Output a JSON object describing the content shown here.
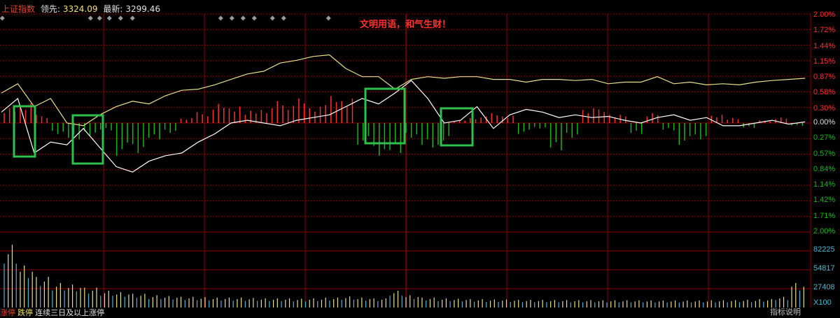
{
  "header": {
    "index_name": "上证指数",
    "lead_label": "领先:",
    "lead_value": "3324.09",
    "last_label": "最新:",
    "last_value": "3299.46"
  },
  "banner": "文明用语，和气生财！",
  "footer": {
    "seg1": "涨停",
    "seg2": "跌停",
    "seg3": "连续三日及以上涨停"
  },
  "indicator_button": "指标说明",
  "colors": {
    "background": "#000000",
    "grid": "#8b0000",
    "up": "#ff2f2f",
    "down": "#17b517",
    "white_line": "#ffffff",
    "yellow_line": "#e8df8e",
    "volume": "#e8df8e",
    "volume_alt": "#4fb4d4",
    "highlight_box": "#2fbf4f"
  },
  "chart_data": {
    "type": "line",
    "price_ticks_upper": [
      "2.00%",
      "1.72%",
      "1.44%",
      "1.15%",
      "0.87%",
      "0.58%",
      "0.30%"
    ],
    "price_tick_zero": "0.00%",
    "price_ticks_lower": [
      "0.27%",
      "0.57%",
      "0.84%",
      "1.14%",
      "1.42%",
      "1.71%",
      "2.00%"
    ],
    "volume_ticks": [
      "82225",
      "54817",
      "27408"
    ],
    "volume_unit": "X100",
    "ylim_percent": [
      -2.0,
      2.0
    ],
    "series": [
      {
        "name": "",
        "color": "white",
        "values": [
          0.2,
          0.45,
          -0.55,
          -0.35,
          -0.4,
          -0.1,
          -0.45,
          -0.8,
          -0.9,
          -0.7,
          -0.6,
          -0.55,
          -0.35,
          -0.2,
          0.0,
          0.05,
          0.0,
          -0.05,
          0.05,
          0.1,
          0.15,
          0.3,
          0.45,
          0.35,
          0.55,
          0.78,
          0.45,
          0.0,
          0.05,
          0.3,
          -0.1,
          0.15,
          0.25,
          0.2,
          0.1,
          0.15,
          0.1,
          0.12,
          0.05,
          0.0,
          0.1,
          0.15,
          0.05,
          0.1,
          -0.05,
          -0.05,
          0.0,
          0.05,
          -0.02,
          0.02
        ]
      },
      {
        "name": "",
        "color": "yellow",
        "values": [
          0.55,
          0.72,
          0.3,
          0.45,
          0.0,
          -0.05,
          0.15,
          0.3,
          0.4,
          0.35,
          0.5,
          0.6,
          0.62,
          0.7,
          0.8,
          0.9,
          0.95,
          1.1,
          1.15,
          1.22,
          1.25,
          1.0,
          0.85,
          0.85,
          0.62,
          0.8,
          0.85,
          0.82,
          0.85,
          0.85,
          0.8,
          0.8,
          0.75,
          0.8,
          0.8,
          0.78,
          0.8,
          0.72,
          0.75,
          0.75,
          0.85,
          0.72,
          0.75,
          0.7,
          0.72,
          0.7,
          0.75,
          0.78,
          0.8,
          0.82
        ]
      }
    ],
    "bars": [
      0.3,
      0.4,
      0.15,
      -0.2,
      -0.3,
      -0.25,
      -0.15,
      -0.6,
      -0.55,
      -0.3,
      -0.2,
      0.1,
      0.2,
      0.35,
      0.3,
      0.25,
      0.3,
      0.4,
      0.45,
      0.3,
      0.55,
      0.5,
      -0.4,
      -0.6,
      -0.55,
      -0.3,
      -0.5,
      -0.4,
      0.05,
      0.1,
      0.2,
      0.15,
      -0.2,
      -0.1,
      -0.5,
      -0.3,
      0.3,
      0.25,
      0.15,
      -0.2,
      0.2,
      -0.15,
      -0.4,
      -0.3,
      0.15,
      0.1,
      -0.1,
      0.05,
      0.1,
      -0.05
    ],
    "volumes": [
      82000,
      55000,
      40000,
      32000,
      30000,
      26000,
      22000,
      20000,
      18000,
      16000,
      15000,
      14000,
      13500,
      13000,
      13000,
      12500,
      12000,
      12000,
      11500,
      12000,
      13000,
      14500,
      13000,
      12000,
      22000,
      16000,
      13000,
      12000,
      11500,
      11000,
      10500,
      10500,
      10000,
      10000,
      9800,
      9700,
      9600,
      9500,
      9500,
      9400,
      9300,
      9200,
      9200,
      9300,
      9500,
      9800,
      10000,
      11000,
      14000,
      32000
    ],
    "highlight_regions": [
      [
        20,
        50
      ],
      [
        104,
        147
      ],
      [
        522,
        578
      ],
      [
        630,
        675
      ]
    ]
  }
}
